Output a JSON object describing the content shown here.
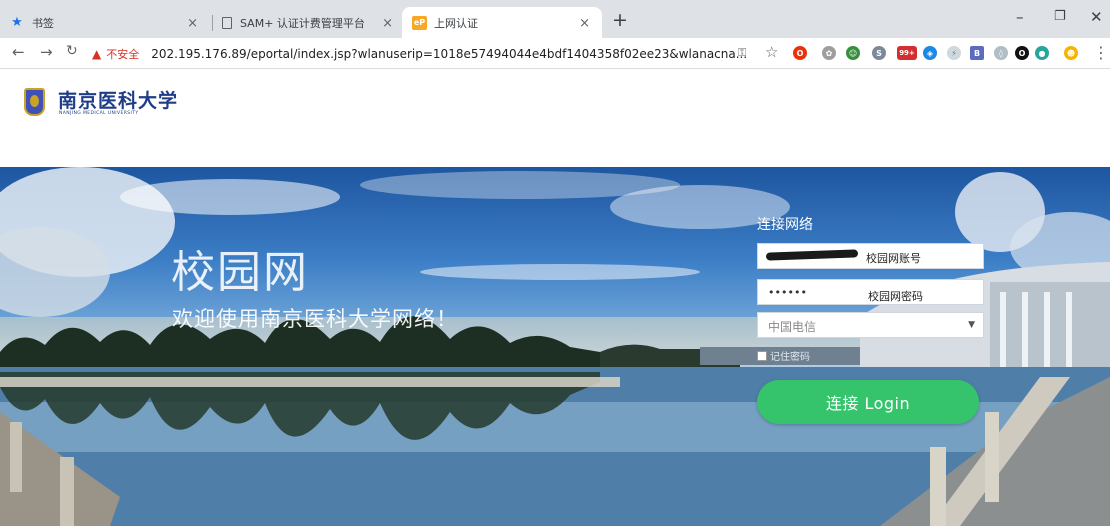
{
  "browser": {
    "tabs": [
      {
        "title": "书签"
      },
      {
        "title": "SAM+ 认证计费管理平台"
      },
      {
        "title": "上网认证",
        "icon_text": "eP"
      }
    ],
    "new_tab": "+",
    "url_security_label": "不安全",
    "url": "202.195.176.89/eportal/index.jsp?wlanuserip=1018e57494044e4bdf1404358f02ee23&wlanacna...",
    "extensions_badge": "99+"
  },
  "header": {
    "logo_cn": "南京医科大学",
    "logo_en": "NANJING MEDICAL UNIVERSITY"
  },
  "hero": {
    "title": "校园网",
    "subtitle": "欢迎使用南京医科大学网络！"
  },
  "login": {
    "panel_title": "连接网络",
    "username_label": "校园网账号",
    "password_value": "••••••",
    "password_label": "校园网密码",
    "carrier_selected": "中国电信",
    "remember_label": "记住密码",
    "button_label": "连接 Login"
  },
  "colors": {
    "login_button": "#35c46b",
    "logo_blue": "#1f3c88",
    "insecure_red": "#d93025"
  }
}
